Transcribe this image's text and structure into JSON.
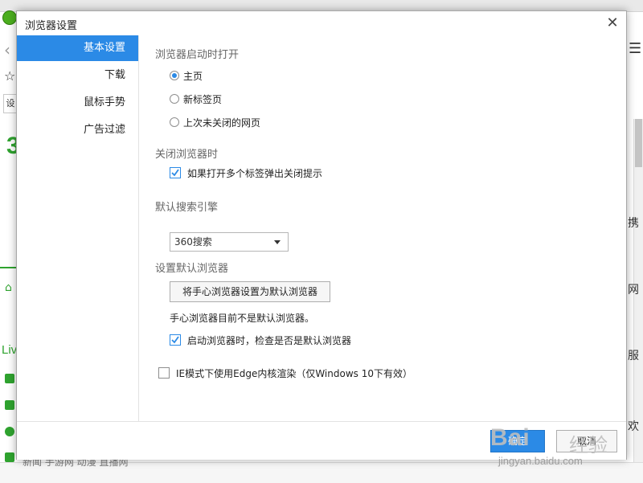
{
  "dialog": {
    "title": "浏览器设置"
  },
  "sidebar": {
    "items": [
      {
        "label": "基本设置",
        "active": true
      },
      {
        "label": "下载",
        "active": false
      },
      {
        "label": "鼠标手势",
        "active": false
      },
      {
        "label": "广告过滤",
        "active": false
      }
    ]
  },
  "startup": {
    "title": "浏览器启动时打开",
    "options": [
      {
        "label": "主页",
        "checked": true
      },
      {
        "label": "新标签页",
        "checked": false
      },
      {
        "label": "上次未关闭的网页",
        "checked": false
      }
    ]
  },
  "close_browser": {
    "title": "关闭浏览器时",
    "option": {
      "label": "如果打开多个标签弹出关闭提示",
      "checked": true
    }
  },
  "search_engine": {
    "title": "默认搜索引擎",
    "selected": "360搜索"
  },
  "default_browser": {
    "title": "设置默认浏览器",
    "button_label": "将手心浏览器设置为默认浏览器",
    "status_text": "手心浏览器目前不是默认浏览器。",
    "check_option": {
      "label": "启动浏览器时，检查是否是默认浏览器",
      "checked": true
    }
  },
  "edge_option": {
    "label": "IE模式下使用Edge内核渲染（仅Windows 10下有效）",
    "checked": false
  },
  "footer": {
    "ok_label": "确定",
    "cancel_label": "取消"
  },
  "background": {
    "left_live_text": "Liv",
    "right_texts": [
      "网",
      "服",
      "欢"
    ],
    "bottom_text": "新闻  手游网  动漫  直播网",
    "addr_char": "设",
    "right_side_char": "携"
  },
  "watermark": {
    "logo": "Bai",
    "cn": "经验",
    "url": "jingyan.baidu.com"
  },
  "colors": {
    "accent": "#2b8ae6",
    "brand_green": "#2fa32f"
  }
}
